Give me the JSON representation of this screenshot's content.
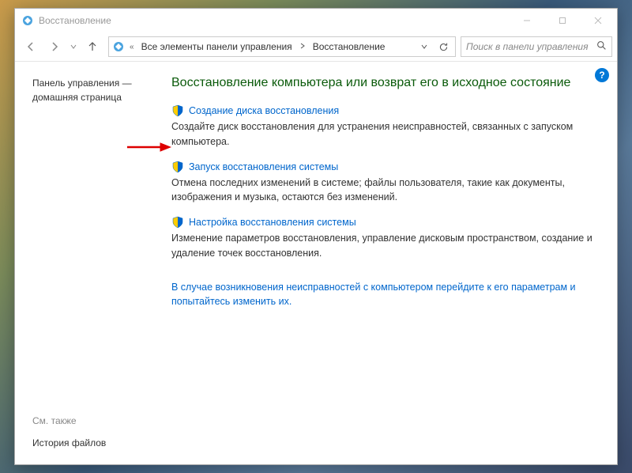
{
  "window": {
    "title": "Восстановление"
  },
  "breadcrumb": {
    "double_arrow": "«",
    "seg1": "Все элементы панели управления",
    "seg2": "Восстановление"
  },
  "search": {
    "placeholder": "Поиск в панели управления"
  },
  "sidebar": {
    "home_link": "Панель управления — домашняя страница",
    "see_also": "См. также",
    "bottom_link": "История файлов"
  },
  "main": {
    "heading": "Восстановление компьютера или возврат его в исходное состояние",
    "options": [
      {
        "link": "Создание диска восстановления",
        "desc": "Создайте диск восстановления для устранения неисправностей, связанных с запуском компьютера."
      },
      {
        "link": "Запуск восстановления системы",
        "desc": "Отмена последних изменений в системе; файлы пользователя, такие как документы, изображения и музыка, остаются без изменений."
      },
      {
        "link": "Настройка восстановления системы",
        "desc": "Изменение параметров восстановления, управление дисковым пространством, создание и удаление точек восстановления."
      }
    ],
    "troubleshoot": "В случае возникновения неисправностей с компьютером перейдите к его параметрам и попытайтесь изменить их."
  }
}
